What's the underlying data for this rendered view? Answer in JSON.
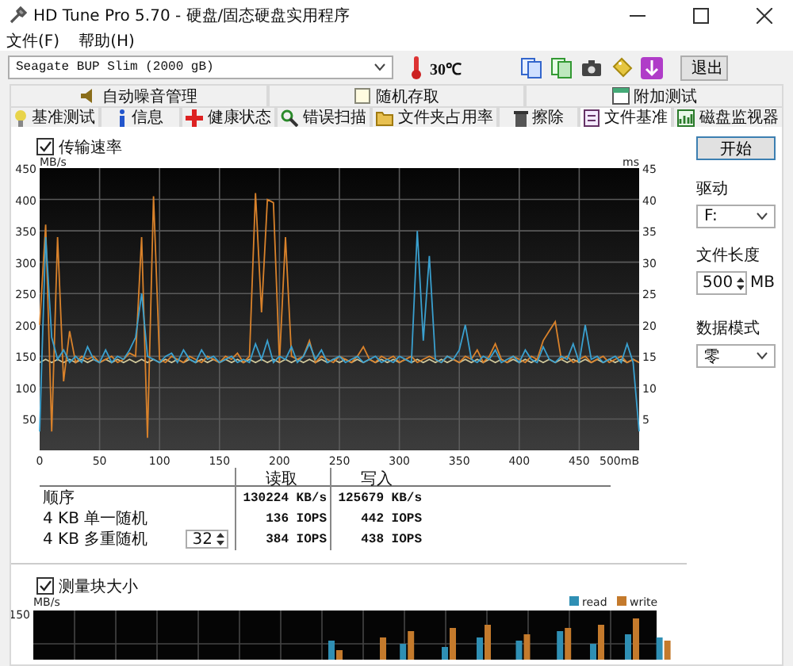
{
  "window": {
    "title": "HD Tune Pro 5.70 - 硬盘/固态硬盘实用程序"
  },
  "menu": [
    "文件(F)",
    "帮助(H)"
  ],
  "toolbar": {
    "drive": "Seagate BUP Slim (2000 gB)",
    "temperature": "30℃",
    "exit_button": "退出"
  },
  "tabs_top": [
    {
      "label": "自动噪音管理",
      "selected": false
    },
    {
      "label": "随机存取",
      "selected": false
    },
    {
      "label": "附加测试",
      "selected": false
    }
  ],
  "tabs": [
    {
      "label": "基准测试",
      "selected": false
    },
    {
      "label": "信息",
      "selected": false
    },
    {
      "label": "健康状态",
      "selected": false
    },
    {
      "label": "错误扫描",
      "selected": false
    },
    {
      "label": "文件夹占用率",
      "selected": false
    },
    {
      "label": "擦除",
      "selected": false
    },
    {
      "label": "文件基准",
      "selected": true
    },
    {
      "label": "磁盘监视器",
      "selected": false
    }
  ],
  "transfer_chart": {
    "checkbox": {
      "label": "传输速率",
      "checked": true
    },
    "y2_unit": "ms",
    "y2_labels": [
      "45",
      "40",
      "35",
      "30",
      "25",
      "20",
      "15",
      "10",
      "5"
    ],
    "chart_data": {
      "type": "line",
      "grid": true,
      "ylabel": "MB/s",
      "xlim": [
        0,
        500
      ],
      "ylim": [
        0,
        450
      ],
      "xticks": [
        0,
        50,
        100,
        150,
        200,
        250,
        300,
        350,
        400,
        450,
        {
          "value": 500,
          "label": "500mB"
        }
      ],
      "yticks": [
        50,
        100,
        150,
        200,
        250,
        300,
        350,
        400,
        450
      ],
      "x": [
        0,
        5,
        10,
        15,
        20,
        25,
        30,
        35,
        40,
        45,
        50,
        55,
        60,
        65,
        70,
        75,
        80,
        85,
        90,
        95,
        100,
        105,
        110,
        115,
        120,
        125,
        130,
        135,
        140,
        145,
        150,
        155,
        160,
        165,
        170,
        175,
        180,
        185,
        190,
        195,
        200,
        205,
        210,
        215,
        220,
        225,
        230,
        235,
        240,
        245,
        250,
        255,
        260,
        265,
        270,
        275,
        280,
        285,
        290,
        295,
        300,
        305,
        310,
        315,
        320,
        325,
        330,
        335,
        340,
        345,
        350,
        355,
        360,
        365,
        370,
        375,
        380,
        385,
        390,
        395,
        400,
        405,
        410,
        415,
        420,
        425,
        430,
        435,
        440,
        445,
        450,
        455,
        460,
        465,
        470,
        475,
        480,
        485,
        490,
        495,
        500
      ],
      "series": [
        {
          "color": "#cfc79a",
          "values": [
            140,
            145,
            140,
            145,
            140,
            145,
            140,
            145,
            140,
            145,
            140,
            145,
            140,
            145,
            140,
            145,
            140,
            145,
            140,
            145,
            140,
            145,
            140,
            145,
            140,
            145,
            140,
            145,
            140,
            145,
            140,
            145,
            140,
            145,
            140,
            145,
            140,
            145,
            140,
            145,
            140,
            145,
            140,
            145,
            140,
            145,
            140,
            145,
            140,
            145,
            140,
            145,
            140,
            145,
            140,
            145,
            140,
            145,
            140,
            145,
            140,
            145,
            140,
            145,
            140,
            145,
            140,
            145,
            140,
            145,
            140,
            145,
            140,
            145,
            140,
            145,
            140,
            145,
            140,
            145,
            140,
            145,
            140,
            145,
            140,
            145,
            140,
            145,
            140,
            145,
            140,
            145,
            140,
            145,
            140,
            145,
            140,
            145,
            140,
            145,
            140
          ]
        },
        {
          "color": "#d9822b",
          "values": [
            200,
            360,
            30,
            340,
            110,
            190,
            140,
            150,
            145,
            150,
            140,
            145,
            150,
            140,
            145,
            155,
            150,
            340,
            20,
            405,
            145,
            140,
            150,
            145,
            140,
            150,
            145,
            140,
            150,
            145,
            140,
            150,
            145,
            155,
            140,
            150,
            410,
            220,
            400,
            395,
            140,
            340,
            150,
            145,
            150,
            175,
            140,
            150,
            145,
            140,
            150,
            145,
            140,
            150,
            165,
            145,
            140,
            150,
            145,
            150,
            140,
            145,
            150,
            140,
            145,
            150,
            145,
            140,
            150,
            145,
            140,
            150,
            145,
            160,
            140,
            150,
            170,
            145,
            140,
            150,
            145,
            140,
            150,
            145,
            175,
            190,
            205,
            145,
            150,
            140,
            145,
            150,
            140,
            145,
            150,
            140,
            145,
            150,
            140,
            145,
            140
          ]
        },
        {
          "color": "#3aa0cf",
          "values": [
            30,
            340,
            180,
            145,
            160,
            140,
            150,
            140,
            165,
            145,
            140,
            160,
            140,
            150,
            145,
            160,
            180,
            250,
            150,
            145,
            140,
            150,
            155,
            140,
            160,
            145,
            140,
            160,
            145,
            150,
            140,
            145,
            150,
            140,
            145,
            140,
            170,
            145,
            175,
            140,
            150,
            145,
            165,
            140,
            150,
            170,
            145,
            160,
            140,
            145,
            150,
            140,
            145,
            150,
            140,
            145,
            150,
            140,
            145,
            140,
            150,
            145,
            140,
            350,
            175,
            310,
            145,
            140,
            150,
            145,
            160,
            200,
            145,
            140,
            150,
            145,
            160,
            140,
            145,
            150,
            140,
            160,
            145,
            140,
            165,
            145,
            140,
            150,
            145,
            170,
            140,
            200,
            145,
            150,
            140,
            145,
            150,
            140,
            170,
            140,
            30
          ]
        }
      ]
    }
  },
  "results": {
    "columns": [
      "读取",
      "写入"
    ],
    "rows": [
      {
        "label": "顺序",
        "read": "130224 KB/s",
        "write": "125679 KB/s"
      },
      {
        "label": "4 KB 单一随机",
        "read": "136 IOPS",
        "write": "442 IOPS"
      },
      {
        "label": "4 KB 多重随机",
        "queue_depth": "32",
        "read": "384 IOPS",
        "write": "438 IOPS"
      }
    ]
  },
  "side_panel": {
    "start_button": "开始",
    "drive_label": "驱动",
    "drive": "F:",
    "file_length_label": "文件长度",
    "file_length": "500",
    "file_length_unit": "MB",
    "data_mode_label": "数据模式",
    "data_mode": "零"
  },
  "block_chart": {
    "checkbox": {
      "label": "测量块大小",
      "checked": true
    },
    "y_unit": "MB/s",
    "y_labels": [
      "150"
    ],
    "legend": [
      {
        "name": "read",
        "color": "#2f8fb4"
      },
      {
        "name": "write",
        "color": "#c47a2c"
      }
    ]
  }
}
